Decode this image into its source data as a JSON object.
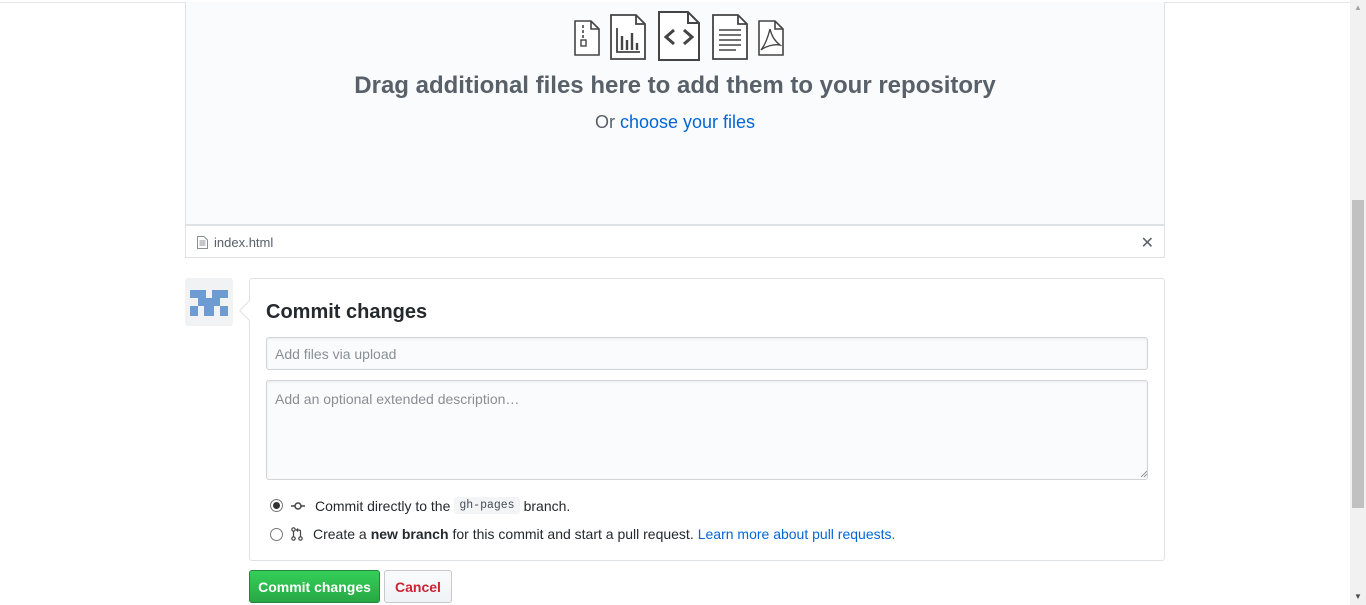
{
  "dropzone": {
    "icons": [
      "zip-file-icon",
      "chart-file-icon",
      "code-file-icon",
      "text-file-icon",
      "pdf-file-icon"
    ],
    "title": "Drag additional files here to add them to your repository",
    "or_text": "Or",
    "choose_link": "choose your files"
  },
  "file": {
    "name": "index.html"
  },
  "commit": {
    "heading": "Commit changes",
    "summary_placeholder": "Add files via upload",
    "description_placeholder": "Add an optional extended description…",
    "option_direct": {
      "prefix": "Commit directly to the",
      "branch": "gh-pages",
      "suffix": "branch.",
      "selected": true
    },
    "option_new": {
      "prefix": "Create a",
      "bold": "new branch",
      "suffix": "for this commit and start a pull request.",
      "link": "Learn more about pull requests.",
      "selected": false
    },
    "submit_label": "Commit changes",
    "cancel_label": "Cancel"
  },
  "colors": {
    "primary_button": "#28a745",
    "link": "#0366d6",
    "cancel_text": "#cb2431"
  }
}
